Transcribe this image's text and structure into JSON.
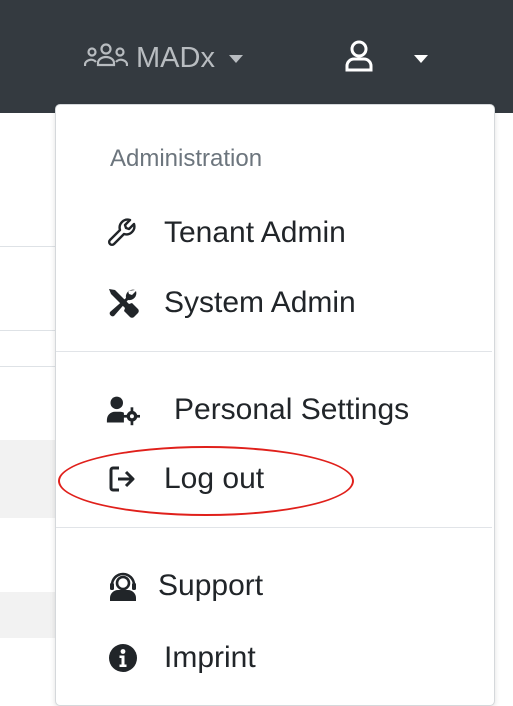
{
  "navbar": {
    "tenant_name": "MADx",
    "tenant_icon": "users-icon",
    "user_icon": "user-icon"
  },
  "menu": {
    "header": "Administration",
    "items": [
      {
        "label": "Tenant Admin",
        "icon": "wrench-icon"
      },
      {
        "label": "System Admin",
        "icon": "tools-icon"
      },
      {
        "label": "Personal Settings",
        "icon": "user-cog-icon"
      },
      {
        "label": "Log out",
        "icon": "sign-out-icon"
      },
      {
        "label": "Support",
        "icon": "headset-icon"
      },
      {
        "label": "Imprint",
        "icon": "info-circle-icon"
      }
    ]
  },
  "colors": {
    "navbar_bg": "#343a40",
    "annotation": "#e0201b"
  }
}
